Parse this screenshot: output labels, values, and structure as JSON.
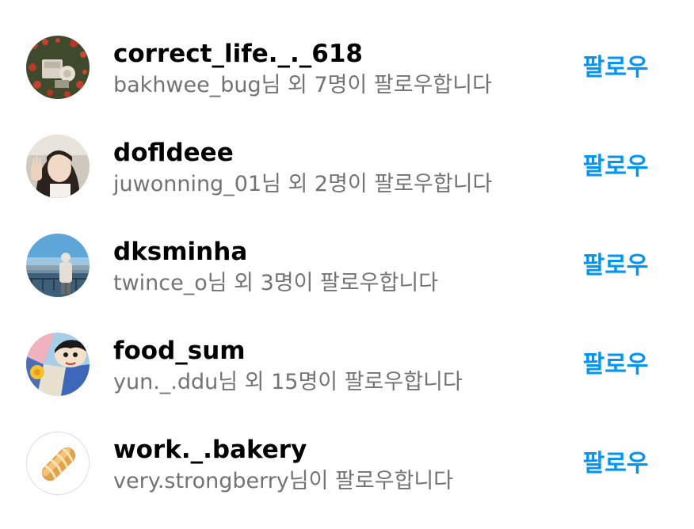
{
  "suggestions": [
    {
      "username": "correct_life._._618",
      "subtitle": "bakhwee_bug님 외 7명이 팔로우합니다",
      "button_label": "팔로우",
      "avatar_icon": "garden-photo-avatar"
    },
    {
      "username": "dofldeee",
      "subtitle": "juwonning_01님 외 2명이 팔로우합니다",
      "button_label": "팔로우",
      "avatar_icon": "selfie-photo-avatar"
    },
    {
      "username": "dksminha",
      "subtitle": "twince_o님 외 3명이 팔로우합니다",
      "button_label": "팔로우",
      "avatar_icon": "seaside-photo-avatar"
    },
    {
      "username": "food_sum",
      "subtitle": "yun._.ddu님 외 15명이 팔로우합니다",
      "button_label": "팔로우",
      "avatar_icon": "cartoon-character-avatar"
    },
    {
      "username": "work._.bakery",
      "subtitle": "very.strongberry님이 팔로우합니다",
      "button_label": "팔로우",
      "avatar_icon": "bread-avatar"
    }
  ],
  "colors": {
    "accent": "#0095f6",
    "username": "#000000",
    "subtitle": "#737373"
  }
}
